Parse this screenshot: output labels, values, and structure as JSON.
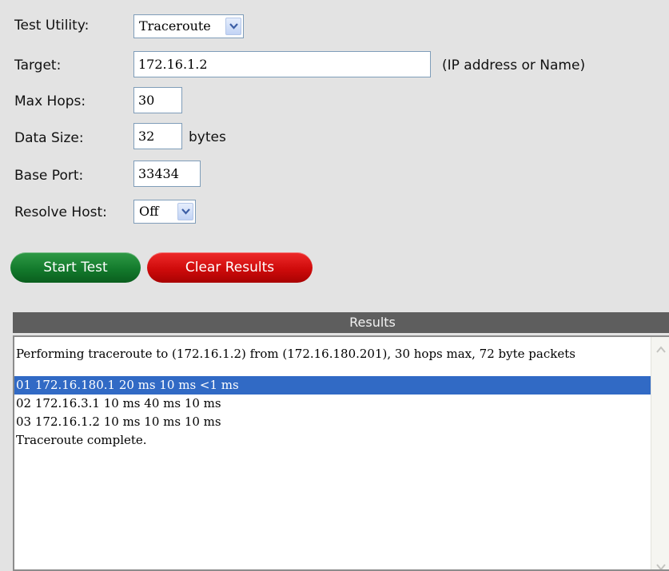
{
  "form": {
    "test_utility": {
      "label": "Test Utility:",
      "value": "Traceroute"
    },
    "target": {
      "label": "Target:",
      "value": "172.16.1.2",
      "hint": "(IP address or Name)"
    },
    "max_hops": {
      "label": "Max Hops:",
      "value": "30"
    },
    "data_size": {
      "label": "Data Size:",
      "value": "32",
      "unit": "bytes"
    },
    "base_port": {
      "label": "Base Port:",
      "value": "33434"
    },
    "resolve_host": {
      "label": "Resolve Host:",
      "value": "Off"
    }
  },
  "buttons": {
    "start": "Start Test",
    "clear": "Clear Results"
  },
  "results": {
    "title": "Results",
    "lines": [
      "Performing traceroute to (172.16.1.2) from (172.16.180.201), 30 hops max, 72 byte packets",
      "",
      "01 172.16.180.1 20 ms 10 ms <1 ms",
      "02 172.16.3.1 10 ms 40 ms 10 ms",
      "03 172.16.1.2 10 ms 10 ms 10 ms",
      "Traceroute complete."
    ],
    "selected_line": "01 172.16.180.1 20 ms 10 ms <1 ms"
  },
  "colors": {
    "background": "#e3e3e3",
    "start_button": "#137a2c",
    "clear_button": "#cf0b0b",
    "results_header": "#5e5e5e",
    "selection": "#316ac5"
  },
  "icons": {
    "dropdown": "chevron-down-icon",
    "scroll_up": "scroll-up-arrow-icon",
    "scroll_down": "scroll-down-arrow-icon"
  }
}
